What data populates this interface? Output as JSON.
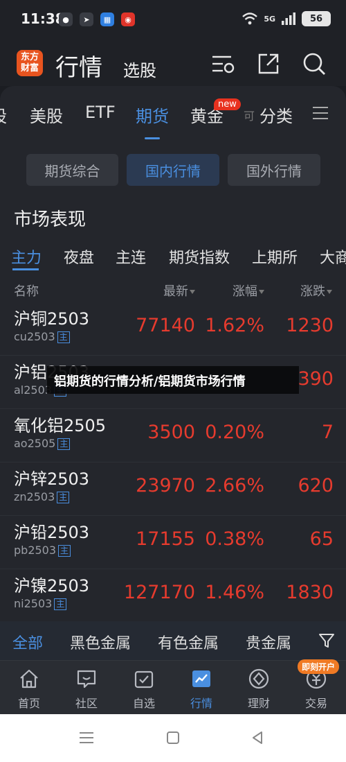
{
  "status": {
    "time": "11:38",
    "network": "5G",
    "battery": "56"
  },
  "header": {
    "logo_text": "东方财富",
    "title": "行情",
    "subtitle": "选股"
  },
  "top_tabs": {
    "items": [
      "股",
      "美股",
      "ETF",
      "期货",
      "黄金",
      "可",
      "分类"
    ],
    "active": "期货",
    "new_badge": "new"
  },
  "segments": {
    "items": [
      "期货综合",
      "国内行情",
      "国外行情"
    ],
    "active": "国内行情"
  },
  "section_title": "市场表现",
  "sub_tabs": {
    "items": [
      "主力",
      "夜盘",
      "主连",
      "期货指数",
      "上期所",
      "大商"
    ],
    "active": "主力"
  },
  "columns": {
    "name": "名称",
    "latest": "最新",
    "pct": "涨幅",
    "change": "涨跌"
  },
  "rows": [
    {
      "name": "沪铜2503",
      "code": "cu2503",
      "tag": "主",
      "latest": "77140",
      "pct": "1.62%",
      "change": "1230"
    },
    {
      "name": "沪铝2503",
      "code": "al2503",
      "tag": "主",
      "latest": "",
      "pct": "",
      "change": "390"
    },
    {
      "name": "氧化铝2505",
      "code": "ao2505",
      "tag": "主",
      "latest": "3500",
      "pct": "0.20%",
      "change": "7"
    },
    {
      "name": "沪锌2503",
      "code": "zn2503",
      "tag": "主",
      "latest": "23970",
      "pct": "2.66%",
      "change": "620"
    },
    {
      "name": "沪铅2503",
      "code": "pb2503",
      "tag": "主",
      "latest": "17155",
      "pct": "0.38%",
      "change": "65"
    },
    {
      "name": "沪镍2503",
      "code": "ni2503",
      "tag": "主",
      "latest": "127170",
      "pct": "1.46%",
      "change": "1830"
    }
  ],
  "overlay_caption": "铝期货的行情分析/铝期货市场行情",
  "category_tabs": {
    "items": [
      "全部",
      "黑色金属",
      "有色金属",
      "贵金属"
    ],
    "active": "全部"
  },
  "bottom_nav": {
    "items": [
      "首页",
      "社区",
      "自选",
      "行情",
      "理财",
      "交易"
    ],
    "active": "行情",
    "open_badge": "即刻开户"
  },
  "colors": {
    "accent": "#4a8fe0",
    "up": "#e63b2e",
    "background": "#1b1d22"
  }
}
